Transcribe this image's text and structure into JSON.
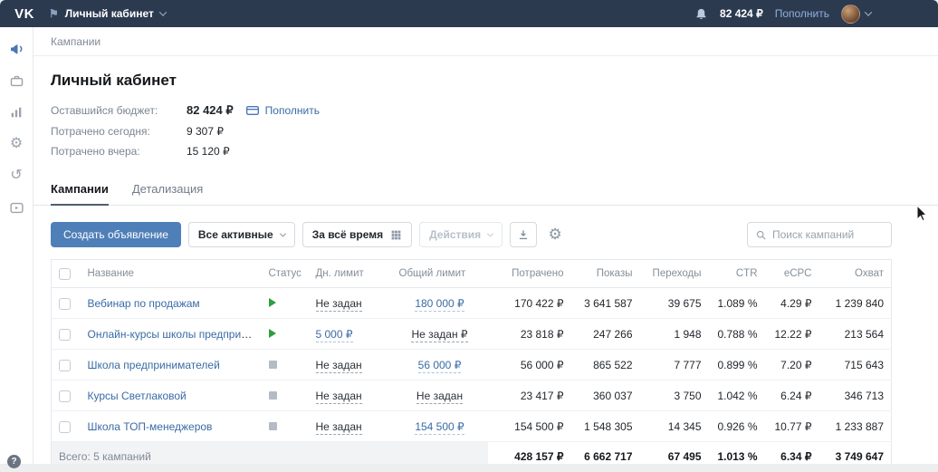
{
  "topbar": {
    "logo_text": "VK",
    "account_name": "Личный кабинет",
    "balance": "82 424 ₽",
    "topup": "Пополнить"
  },
  "breadcrumb": "Кампании",
  "overview": {
    "title": "Личный кабинет",
    "budget_label": "Оставшийся бюджет:",
    "budget_value": "82 424 ₽",
    "budget_action": "Пополнить",
    "today_label": "Потрачено сегодня:",
    "today_value": "9 307 ₽",
    "yesterday_label": "Потрачено вчера:",
    "yesterday_value": "15 120 ₽"
  },
  "tabs": [
    {
      "label": "Кампании"
    },
    {
      "label": "Детализация"
    }
  ],
  "toolbar": {
    "create": "Создать объявление",
    "filter": "Все активные",
    "period": "За всё время",
    "actions": "Действия",
    "search_placeholder": "Поиск кампаний"
  },
  "table": {
    "headers": [
      "Название",
      "Статус",
      "Дн. лимит",
      "Общий лимит",
      "Потрачено",
      "Показы",
      "Переходы",
      "CTR",
      "eCPC",
      "Охват"
    ],
    "rows": [
      {
        "name": "Вебинар по продажам",
        "status": "active",
        "day_limit": "Не задан",
        "total_limit": "180 000 ₽",
        "spent": "170 422 ₽",
        "shows": "3 641 587",
        "clicks": "39 675",
        "ctr": "1.089 %",
        "ecpc": "4.29 ₽",
        "reach": "1 239 840"
      },
      {
        "name": "Онлайн-курсы школы предприн…",
        "status": "active",
        "day_limit": "5 000 ₽",
        "total_limit": "Не задан ₽",
        "spent": "23 818 ₽",
        "shows": "247 266",
        "clicks": "1 948",
        "ctr": "0.788 %",
        "ecpc": "12.22 ₽",
        "reach": "213 564"
      },
      {
        "name": "Школа предпринимателей",
        "status": "paused",
        "day_limit": "Не задан",
        "total_limit": "56 000 ₽",
        "spent": "56 000 ₽",
        "shows": "865 522",
        "clicks": "7 777",
        "ctr": "0.899 %",
        "ecpc": "7.20 ₽",
        "reach": "715 643"
      },
      {
        "name": "Курсы Светлаковой",
        "status": "paused",
        "day_limit": "Не задан",
        "total_limit": "Не задан",
        "spent": "23 417 ₽",
        "shows": "360 037",
        "clicks": "3 750",
        "ctr": "1.042 %",
        "ecpc": "6.24 ₽",
        "reach": "346 713"
      },
      {
        "name": "Школа ТОП-менеджеров",
        "status": "paused",
        "day_limit": "Не задан",
        "total_limit": "154 500 ₽",
        "spent": "154 500 ₽",
        "shows": "1 548 305",
        "clicks": "14 345",
        "ctr": "0.926 %",
        "ecpc": "10.77 ₽",
        "reach": "1 233 887"
      }
    ],
    "footer": {
      "label": "Всего: 5 кампаний",
      "spent": "428 157 ₽",
      "shows": "6 662 717",
      "clicks": "67 495",
      "ctr": "1.013 %",
      "ecpc": "6.34 ₽",
      "reach": "3 749 647"
    }
  },
  "glyphs": {
    "flag": "⚑",
    "gear": "⚙",
    "undo": "↺",
    "help": "?"
  }
}
